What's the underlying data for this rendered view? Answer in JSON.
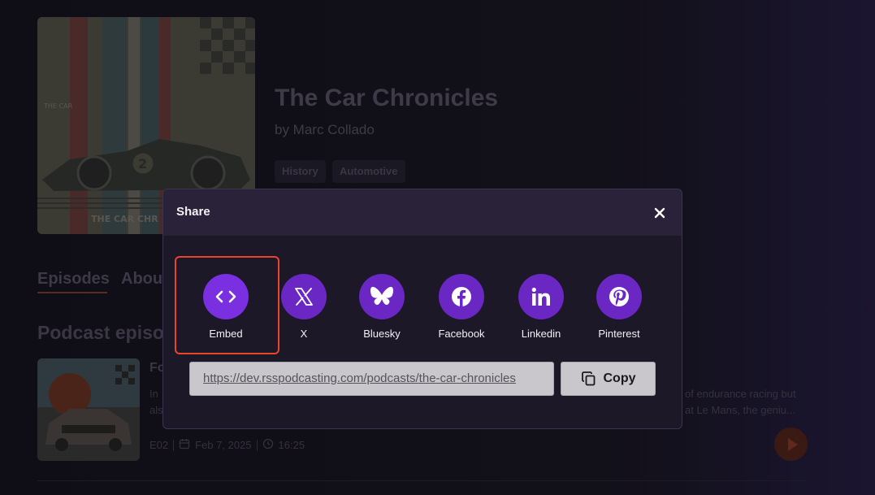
{
  "podcast": {
    "title": "The Car Chronicles",
    "author": "by Marc Collado",
    "tags": [
      "History",
      "Automotive"
    ],
    "cover_text_top": "THE CAR",
    "cover_text_bottom": "THE CAR CHR",
    "cover_number": "2"
  },
  "tabs": {
    "episodes": "Episodes",
    "about": "About"
  },
  "section_title": "Podcast episo",
  "episode": {
    "title_fragment": "Fo",
    "desc_left_1": "In",
    "desc_left_2": "als",
    "desc_right_1": "of endurance racing but",
    "desc_right_2": "at Le Mans, the geniu...",
    "number": "E02",
    "date": "Feb 7, 2025",
    "duration": "16:25"
  },
  "modal": {
    "title": "Share",
    "share_options": [
      {
        "label": "Embed",
        "icon": "embed-code-icon"
      },
      {
        "label": "X",
        "icon": "x-logo-icon"
      },
      {
        "label": "Bluesky",
        "icon": "bluesky-butterfly-icon"
      },
      {
        "label": "Facebook",
        "icon": "facebook-logo-icon"
      },
      {
        "label": "Linkedin",
        "icon": "linkedin-logo-icon"
      },
      {
        "label": "Pinterest",
        "icon": "pinterest-logo-icon"
      }
    ],
    "url": "https://dev.rsspodcasting.com/podcasts/the-car-chronicles",
    "copy_label": "Copy"
  },
  "colors": {
    "accent_purple": "#6a27c4",
    "highlight_red": "#e8452b",
    "modal_bg": "#1c1828",
    "modal_header": "#2a2238"
  }
}
